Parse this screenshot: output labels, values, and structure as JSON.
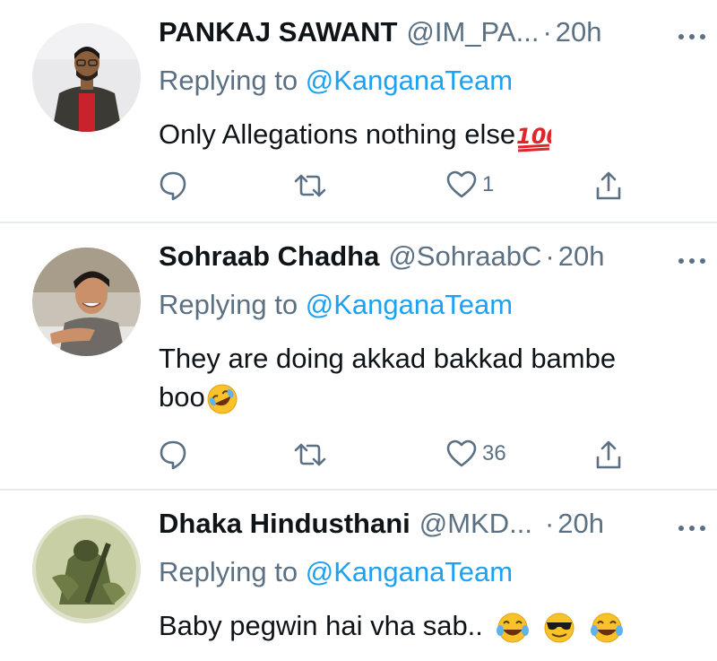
{
  "tweets": [
    {
      "name": "PANKAJ SAWANT",
      "handle": "@IM_PA...",
      "time": "20h",
      "replying_prefix": "Replying to",
      "replying_to": "@KanganaTeam",
      "text": "Only Allegations nothing else",
      "emoji": "hundred-points",
      "likes": "1",
      "avatar": "man-with-glasses-red-shirt"
    },
    {
      "name": "Sohraab Chadha",
      "handle": "@SohraabC",
      "time": "20h",
      "replying_prefix": "Replying to",
      "replying_to": "@KanganaTeam",
      "text_line1": "They are doing akkad bakkad bambe",
      "text_line2": "boo",
      "emoji": "rolling-on-floor-laughing",
      "likes": "36",
      "avatar": "smiling-man-at-desk"
    },
    {
      "name": "Dhaka Hindusthani",
      "handle": "@MKD...",
      "time": "20h",
      "replying_prefix": "Replying to",
      "replying_to": "@KanganaTeam",
      "text": "Baby pegwin hai vha sab..",
      "emojis": [
        "tears-of-joy",
        "sunglasses-face",
        "tears-of-joy"
      ],
      "avatar": "soldier-artwork"
    }
  ],
  "separator": "·",
  "colors": {
    "secondary": "#5b7083",
    "accent": "#1da1f2",
    "divider": "#e6ecf0"
  }
}
